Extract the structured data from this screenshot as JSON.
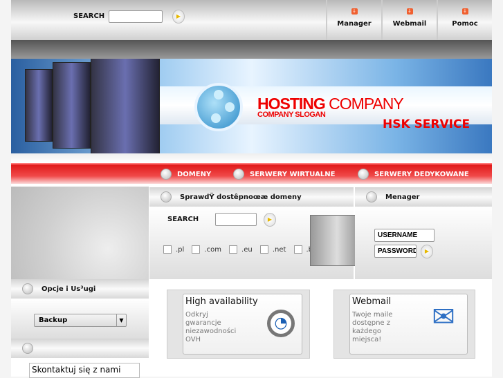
{
  "top": {
    "search_label": "SEARCH",
    "search_value": "",
    "links": [
      {
        "label": "Manager"
      },
      {
        "label": "Webmail"
      },
      {
        "label": "Pomoc"
      }
    ]
  },
  "banner": {
    "brand_bold": "HOSTING",
    "brand_rest": " COMPANY",
    "slogan": "COMPANY SLOGAN",
    "service": "HSK SERVICE"
  },
  "nav": [
    {
      "label": "DOMENY"
    },
    {
      "label": "SERWERY WIRTUALNE"
    },
    {
      "label": "SERWERY DEDYKOWANE"
    }
  ],
  "domain_check": {
    "title": "SprawdŸ dostêpnoœæ domeny",
    "search_label": "SEARCH",
    "search_value": "",
    "tlds": [
      ".pl",
      ".com",
      ".eu",
      ".net",
      ".biz"
    ]
  },
  "manager": {
    "title": "Menager",
    "username": "USERNAME",
    "password": "PASSWORD"
  },
  "sidebar": {
    "options_title": "Opcje i Us³ugi",
    "select_value": "Backup",
    "contact": "Skontaktuj się z nami"
  },
  "cards": [
    {
      "title": "High availability",
      "text": "Odkryj gwarancje niezawodności OVH"
    },
    {
      "title": "Webmail",
      "text": "Twoje maile dostępne z każdego miejsca!"
    }
  ]
}
